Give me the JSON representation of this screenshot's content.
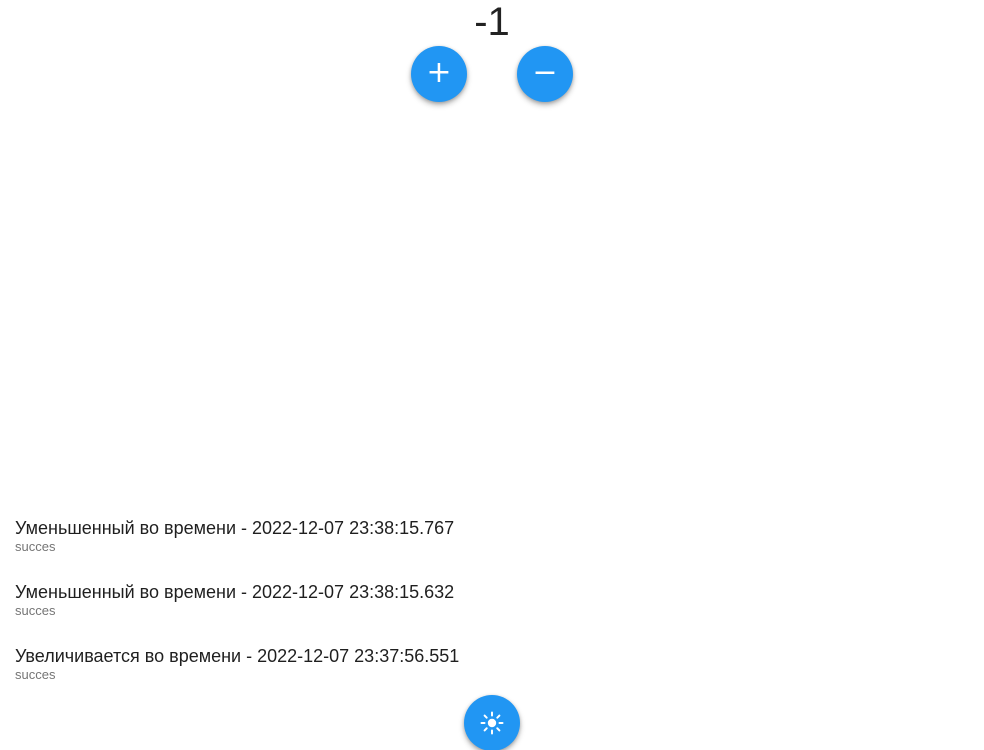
{
  "counter": {
    "value": "-1"
  },
  "buttons": {
    "increment_glyph": "+",
    "decrement_glyph": "−",
    "theme_icon": "sun-icon"
  },
  "history": [
    {
      "title": "Уменьшенный во времени - 2022-12-07 23:38:15.767",
      "subtitle": "succes"
    },
    {
      "title": "Уменьшенный во времени - 2022-12-07 23:38:15.632",
      "subtitle": "succes"
    },
    {
      "title": "Увеличивается во времени - 2022-12-07 23:37:56.551",
      "subtitle": "succes"
    }
  ],
  "colors": {
    "accent": "#2196f3",
    "background": "#ffffff",
    "subtitle": "#757575"
  }
}
